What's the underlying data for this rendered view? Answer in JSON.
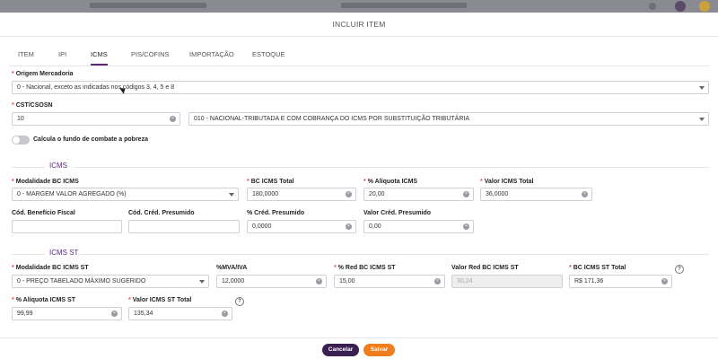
{
  "modal": {
    "title": "INCLUIR ITEM"
  },
  "tabs": [
    "ITEM",
    "IPI",
    "ICMS",
    "PIS/COFINS",
    "IMPORTAÇÃO",
    "ESTOQUE"
  ],
  "active_tab": "ICMS",
  "origem": {
    "label": "Origem Mercadoria",
    "value": "0 - Nacional, exceto as indicadas nos códigos 3, 4, 5 e 8"
  },
  "cst": {
    "label": "CST/CSOSN",
    "code": "10",
    "description": "010 - NACIONAL-TRIBUTADA E COM COBRANÇA DO ICMS POR SUBSTITUIÇÃO TRIBUTÁRIA"
  },
  "fcp_toggle": {
    "label": "Calcula o fundo de combate a pobreza",
    "on": false
  },
  "icms": {
    "section_title": "ICMS",
    "modalidade": {
      "label": "Modalidade BC ICMS",
      "value": "0 - MARGEM VALOR AGREGADO (%)"
    },
    "bc_total": {
      "label": "BC ICMS Total",
      "value": "180,0000"
    },
    "aliquota": {
      "label": "% Alíquota ICMS",
      "value": "20,00"
    },
    "valor_total": {
      "label": "Valor ICMS Total",
      "value": "36,0000"
    },
    "cod_beneficio": {
      "label": "Cód. Benefício Fiscal",
      "value": ""
    },
    "cod_cred_presumido": {
      "label": "Cód. Créd. Presumido",
      "value": ""
    },
    "perc_cred_presumido": {
      "label": "% Créd. Presumido",
      "value": "0,0000"
    },
    "valor_cred_presumido": {
      "label": "Valor Créd. Presumido",
      "value": "0,00"
    }
  },
  "icms_st": {
    "section_title": "ICMS ST",
    "modalidade": {
      "label": "Modalidade BC ICMS ST",
      "value": "0 - PREÇO TABELADO MÁXIMO SUGERIDO"
    },
    "mva": {
      "label": "%MVA/IVA",
      "value": "12,0000"
    },
    "red_bc": {
      "label": "% Red BC ICMS ST",
      "value": "15,00"
    },
    "valor_red_bc": {
      "label": "Valor Red BC ICMS ST",
      "value": "30,24"
    },
    "bc_total": {
      "label": "BC ICMS ST Total",
      "value": "R$ 171,36"
    },
    "aliquota": {
      "label": "% Alíquota ICMS ST",
      "value": "99,99"
    },
    "valor_total": {
      "label": "Valor ICMS ST Total",
      "value": "135,34"
    }
  },
  "buttons": {
    "cancel": "Cancelar",
    "save": "Salvar"
  },
  "colors": {
    "accent": "#5a2a7a",
    "save": "#f07d1e",
    "cancel": "#3b1f52",
    "required": "#e24c4c"
  },
  "icons": {
    "clear": "x-circle-icon",
    "dropdown": "chevron-down-icon",
    "help": "question-icon"
  }
}
